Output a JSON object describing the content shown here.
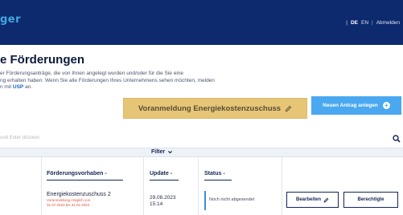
{
  "header": {
    "brand": "ger",
    "lang_de": "DE",
    "lang_en": "EN",
    "logout": "Abmelden",
    "separator": "|",
    "background": "#0d2a6e",
    "brand_color": "#3fa9e0"
  },
  "page": {
    "title": "e Förderungen",
    "intro_line1": "er Förderungsanträge, die von Ihnen angelegt wurden und/oder für die Sie eine",
    "intro_line2": "ng erhalten haben. Wenn Sie alle Förderungen Ihres Unternehmens sehen möchten, melden",
    "intro_line3_prefix": "n mit ",
    "intro_link": "USP",
    "intro_line3_suffix": " an."
  },
  "actions": {
    "voranmeldung_label": "Voranmeldung Energiekostenzuschuss",
    "voranmeldung_icon": "pencil-icon",
    "voranmeldung_color": "#e2bc60",
    "neuer_antrag_label": "Neuen Antrag anlegen",
    "neuer_antrag_icon": "plus-circle-icon",
    "neuer_antrag_color": "#4aa8f0"
  },
  "search": {
    "placeholder": "und Enter drücken",
    "icon": "search-icon"
  },
  "filter": {
    "label": "Filter",
    "icon": "chevron-down-icon"
  },
  "table": {
    "columns": [
      {
        "label": "Förderungsvorhaben",
        "sort": "-"
      },
      {
        "label": "Update",
        "sort": "-"
      },
      {
        "label": "Status",
        "sort": "-"
      }
    ],
    "rows": [
      {
        "name": "Energiekostenzuschuss 2",
        "note_line1": "Voranmeldung möglich von",
        "note_line2": "01.07.2023 bis 31.01.2024",
        "date": "29.08.2023",
        "time": "15:14",
        "status": "Noch nicht abgesendet",
        "edit_label": "Bearbeiten",
        "edit_icon": "pencil-icon",
        "permissions_label": "Berechtigte"
      }
    ],
    "status_color": "#3b8ede",
    "note_color": "#e0533a"
  }
}
